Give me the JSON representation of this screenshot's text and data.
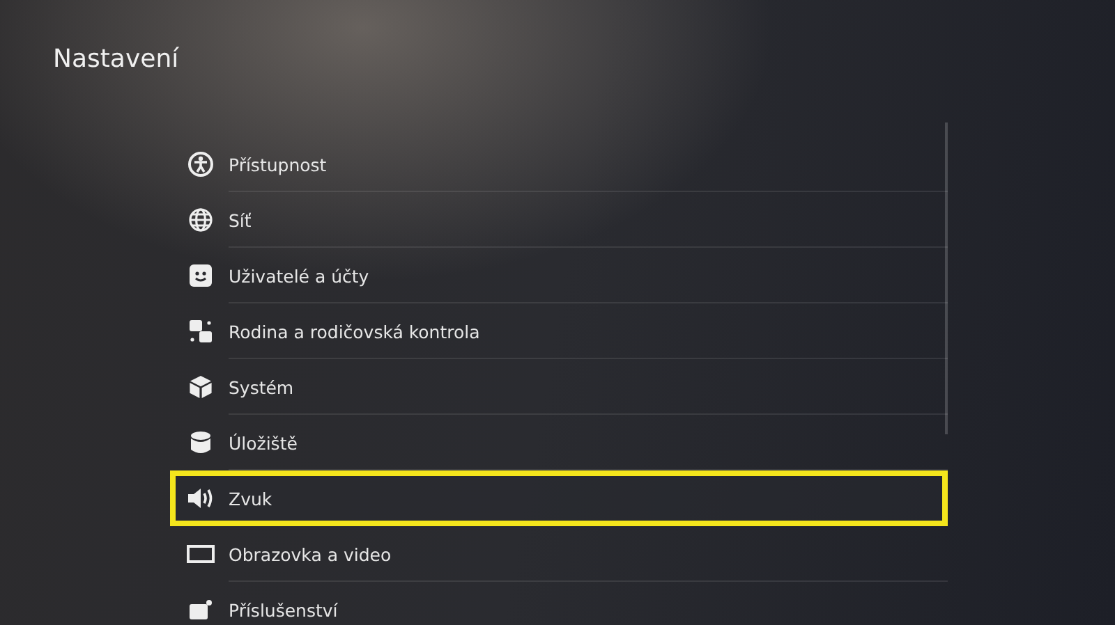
{
  "header": {
    "title": "Nastavení"
  },
  "menu": [
    {
      "label": "Přístupnost",
      "selected": false
    },
    {
      "label": "Síť",
      "selected": false
    },
    {
      "label": "Uživatelé a účty",
      "selected": false
    },
    {
      "label": "Rodina a rodičovská kontrola",
      "selected": false
    },
    {
      "label": "Systém",
      "selected": false
    },
    {
      "label": "Úložiště",
      "selected": false
    },
    {
      "label": "Zvuk",
      "selected": true
    },
    {
      "label": "Obrazovka a video",
      "selected": false
    },
    {
      "label": "Příslušenství",
      "selected": false
    }
  ]
}
